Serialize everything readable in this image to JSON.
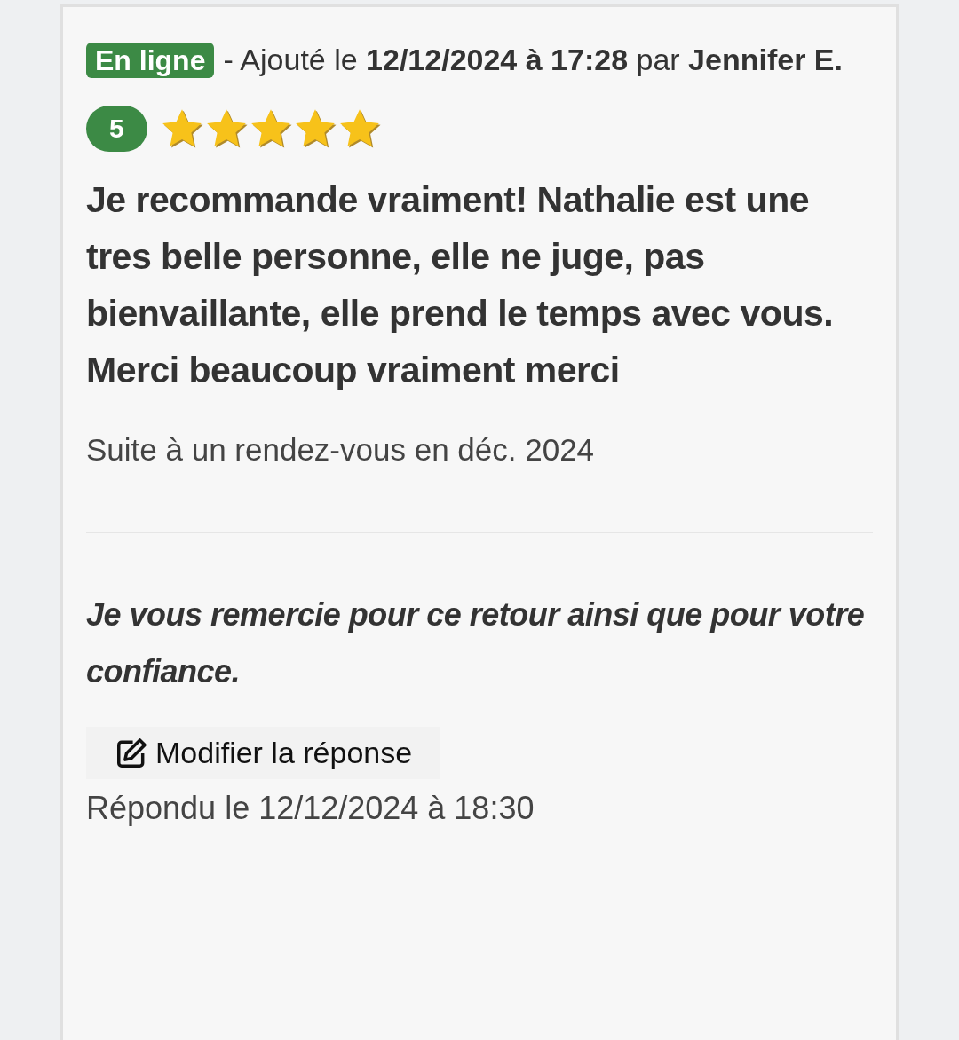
{
  "review": {
    "status_badge": "En ligne",
    "byline": "- Ajouté le **12/12/2024 à 17:28** par **Jennifer E.**",
    "score": "5",
    "stars": 5,
    "text": "Je recommande vraiment! Nathalie est une tres belle personne, elle ne juge, pas bienvaillante, elle prend le temps avec vous. Merci beaucoup vraiment merci",
    "context": "Suite à un rendez-vous en déc. 2024"
  },
  "reply": {
    "text": "Je vous remercie pour ce retour ainsi que pour votre confiance.",
    "edit_button": "Modifier la réponse",
    "replied_at": "Répondu le 12/12/2024 à 18:30"
  }
}
